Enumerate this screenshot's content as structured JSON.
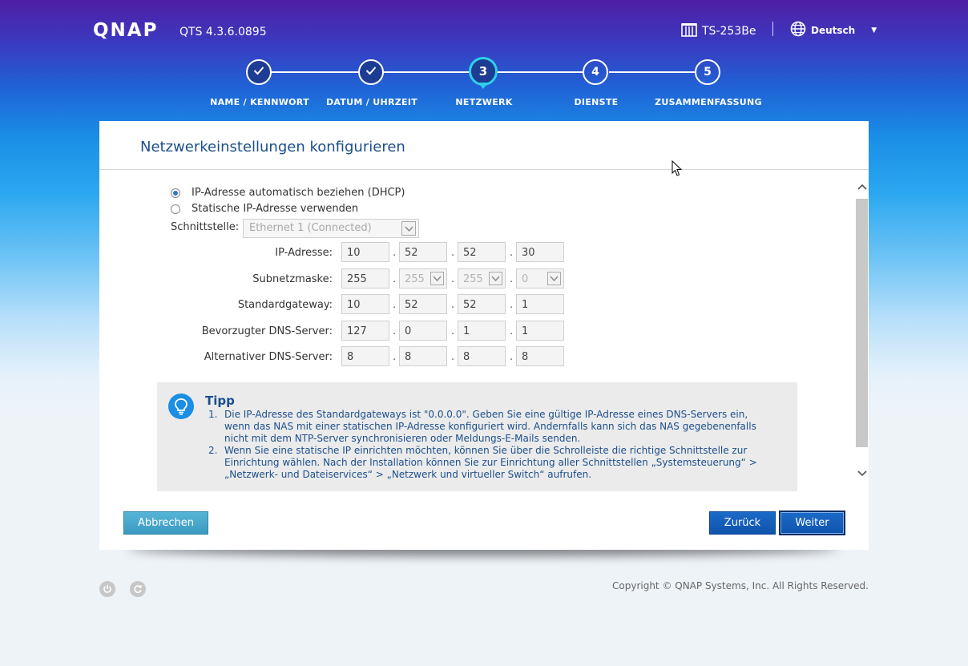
{
  "header": {
    "logo": "QNAP",
    "version": "QTS 4.3.6.0895",
    "device": "TS-253Be",
    "language": "Deutsch",
    "icons": {
      "device": "nas-icon",
      "language": "globe-icon",
      "dropdown": "caret-down-icon"
    }
  },
  "stepper": {
    "steps": [
      {
        "number": "1",
        "label": "NAME / KENNWORT",
        "state": "done"
      },
      {
        "number": "2",
        "label": "DATUM / UHRZEIT",
        "state": "done"
      },
      {
        "number": "3",
        "label": "NETZWERK",
        "state": "current"
      },
      {
        "number": "4",
        "label": "DIENSTE",
        "state": "todo"
      },
      {
        "number": "5",
        "label": "ZUSAMMENFASSUNG",
        "state": "todo"
      }
    ]
  },
  "card": {
    "title": "Netzwerkeinstellungen konfigurieren",
    "radio_dhcp": "IP-Adresse automatisch beziehen (DHCP)",
    "radio_static": "Statische IP-Adresse verwenden",
    "selected_radio": "dhcp",
    "interface_label": "Schnittstelle:",
    "interface_value": "Ethernet 1 (Connected)",
    "rows": [
      {
        "label": "IP-Adresse:",
        "values": [
          "10",
          "52",
          "52",
          "30"
        ]
      },
      {
        "label": "Subnetzmaske:",
        "values": [
          "255",
          "255",
          "255",
          "0"
        ]
      },
      {
        "label": "Standardgateway:",
        "values": [
          "10",
          "52",
          "52",
          "1"
        ]
      },
      {
        "label": "Bevorzugter DNS-Server:",
        "values": [
          "127",
          "0",
          "1",
          "1"
        ]
      },
      {
        "label": "Alternativer DNS-Server:",
        "values": [
          "8",
          "8",
          "8",
          "8"
        ]
      }
    ],
    "tip": {
      "title": "Tipp",
      "items": [
        {
          "num": "1.",
          "text": "Die IP-Adresse des Standardgateways ist \"0.0.0.0\". Geben Sie eine gültige IP-Adresse eines DNS-Servers ein, wenn das NAS mit einer statischen IP-Adresse konfiguriert wird. Andernfalls kann sich das NAS gegebenenfalls nicht mit dem NTP-Server synchronisieren oder Meldungs-E-Mails senden."
        },
        {
          "num": "2.",
          "text": "Wenn Sie eine statische IP einrichten möchten, können Sie über die Schrolleiste die richtige Schnittstelle zur Einrichtung wählen. Nach der Installation können Sie zur Einrichtung aller Schnittstellen „Systemsteuerung“ > „Netzwerk- und Dateiservices“ > „Netzwerk und virtueller Switch“ aufrufen."
        }
      ]
    },
    "buttons": {
      "cancel": "Abbrechen",
      "back": "Zurück",
      "next": "Weiter"
    }
  },
  "footer": {
    "copyright": "Copyright © QNAP Systems, Inc. All Rights Reserved.",
    "icons": [
      "power-icon",
      "restart-icon"
    ]
  },
  "colors": {
    "accent": "#1c4f8c",
    "button_primary": "#1660bd",
    "button_cancel": "#4aa7cd",
    "step_done": "#1d3c93",
    "step_current_ring": "#2ed0e8"
  }
}
